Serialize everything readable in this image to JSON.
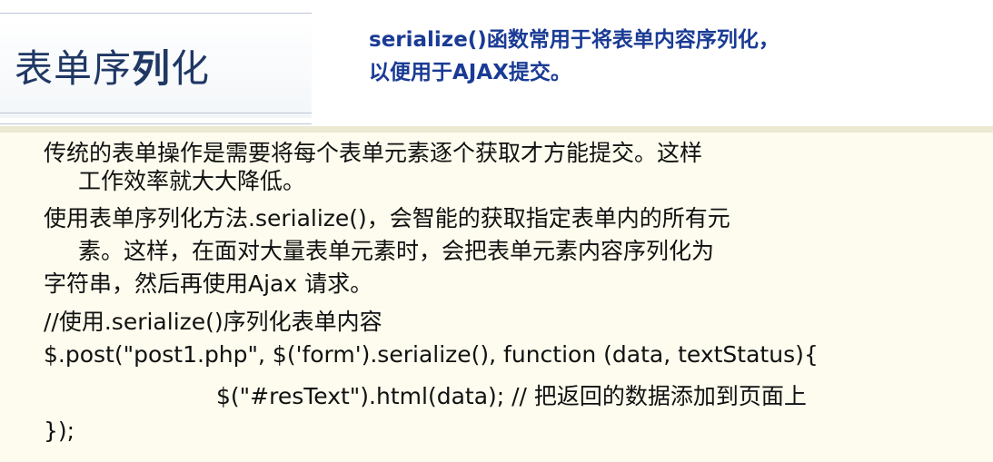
{
  "slide": {
    "title_normal": "表单序",
    "title_bold": "列",
    "title_end": "化",
    "subtitle_line1": "serialize()函数常用于将表单内容序列化，",
    "subtitle_line2": "以便用于AJAX提交。"
  },
  "body": {
    "lines": [
      "传统的表单操作是需要将每个表单元素逐个获取才方能提交。这样",
      "工作效率就大大降低。",
      "使用表单序列化方法.serialize()，会智能的获取指定表单内的所有元",
      "素。这样，在面对大量表单元素时，会把表单元素内容序列化为",
      "字符串，然后再使用Ajax 请求。",
      "//使用.serialize()序列化表单内容",
      "$.post(\"post1.php\", $('form').serialize(), function (data, textStatus){",
      "$(\"#resText\").html(data); // 把返回的数据添加到页面上",
      "});"
    ]
  },
  "colors": {
    "title": "#1f3864",
    "subtitle": "#1a3b95",
    "content_bg": "#fdfcee"
  }
}
